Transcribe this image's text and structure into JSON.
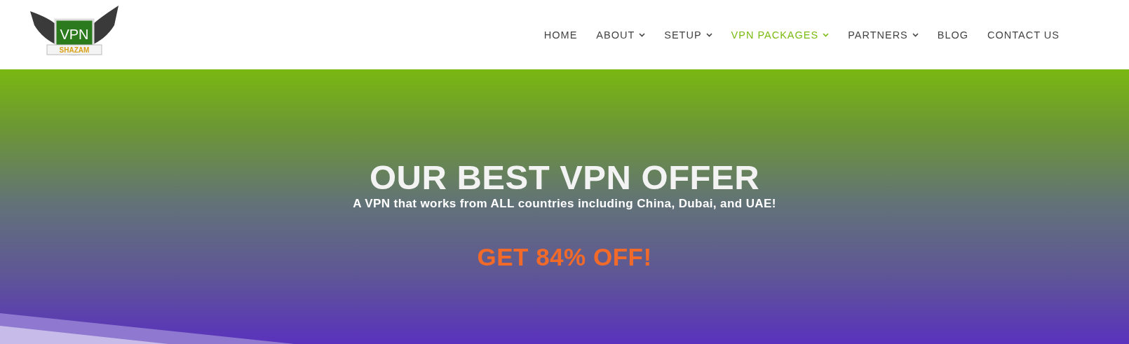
{
  "logo": {
    "top": "VPN",
    "bottom": "SHAZAM"
  },
  "nav": [
    {
      "label": "HOME",
      "has_menu": false,
      "selected": false
    },
    {
      "label": "ABOUT",
      "has_menu": true,
      "selected": false
    },
    {
      "label": "SETUP",
      "has_menu": true,
      "selected": false
    },
    {
      "label": "VPN PACKAGES",
      "has_menu": true,
      "selected": true
    },
    {
      "label": "PARTNERS",
      "has_menu": true,
      "selected": false
    },
    {
      "label": "BLOG",
      "has_menu": false,
      "selected": false
    },
    {
      "label": "CONTACT US",
      "has_menu": false,
      "selected": false
    }
  ],
  "hero": {
    "title": "OUR BEST VPN OFFER",
    "subtitle": "A VPN that works from ALL countries including China, Dubai, and UAE!",
    "offer": "GET 84% OFF!"
  }
}
